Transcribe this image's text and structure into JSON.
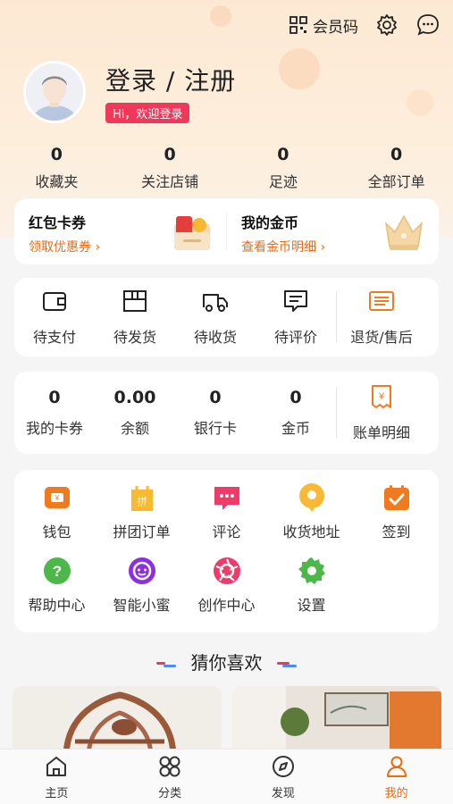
{
  "topbar": {
    "member_code_label": "会员码"
  },
  "profile": {
    "title": "登录 / 注册",
    "welcome": "Hi，欢迎登录"
  },
  "stats": [
    {
      "value": "0",
      "label": "收藏夹"
    },
    {
      "value": "0",
      "label": "关注店铺"
    },
    {
      "value": "0",
      "label": "足迹"
    },
    {
      "value": "0",
      "label": "全部订单"
    }
  ],
  "coupons": {
    "left": {
      "title": "红包卡券",
      "link": "领取优惠券 ›"
    },
    "right": {
      "title": "我的金币",
      "link": "查看金币明细 ›"
    }
  },
  "orders": [
    {
      "label": "待支付",
      "icon": "wallet-icon"
    },
    {
      "label": "待发货",
      "icon": "box-icon"
    },
    {
      "label": "待收货",
      "icon": "truck-icon"
    },
    {
      "label": "待评价",
      "icon": "comment-icon"
    },
    {
      "label": "退货/售后",
      "icon": "refund-icon"
    }
  ],
  "wallet": [
    {
      "value": "0",
      "label": "我的卡券"
    },
    {
      "value": "0.00",
      "label": "余额"
    },
    {
      "value": "0",
      "label": "银行卡"
    },
    {
      "value": "0",
      "label": "金币"
    }
  ],
  "wallet_bill": {
    "label": "账单明细",
    "icon": "bill-icon"
  },
  "services": [
    {
      "label": "钱包",
      "icon": "wallet-icon"
    },
    {
      "label": "拼团订单",
      "icon": "group-order-icon"
    },
    {
      "label": "评论",
      "icon": "comment-icon"
    },
    {
      "label": "收货地址",
      "icon": "location-icon"
    },
    {
      "label": "签到",
      "icon": "checkin-icon"
    },
    {
      "label": "帮助中心",
      "icon": "help-icon"
    },
    {
      "label": "智能小蜜",
      "icon": "assistant-icon"
    },
    {
      "label": "创作中心",
      "icon": "aperture-icon"
    },
    {
      "label": "设置",
      "icon": "settings-icon"
    }
  ],
  "guess_title": "猜你喜欢",
  "tabs": [
    {
      "label": "主页",
      "icon": "home-icon",
      "active": false
    },
    {
      "label": "分类",
      "icon": "grid-icon",
      "active": false
    },
    {
      "label": "发现",
      "icon": "compass-icon",
      "active": false
    },
    {
      "label": "我的",
      "icon": "person-icon",
      "active": true
    }
  ],
  "colors": {
    "accent": "#f06a12",
    "badge": "#f0385a",
    "orange_icon": "#f07a1e"
  }
}
